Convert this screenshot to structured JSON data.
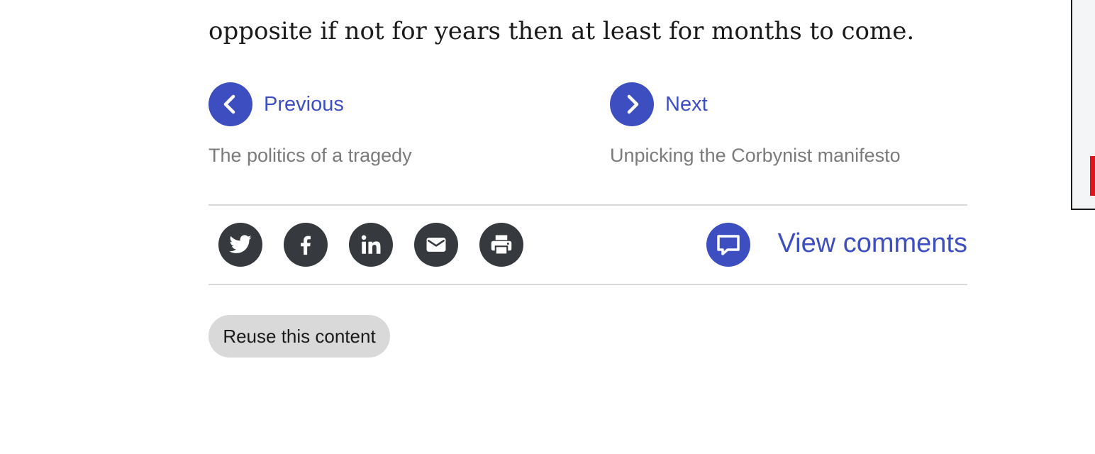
{
  "article": {
    "closing_text": "opposite if not for years then at least for months to come."
  },
  "pagination": {
    "previous": {
      "label": "Previous",
      "title": "The politics of a tragedy",
      "icon": "chevron-left-icon"
    },
    "next": {
      "label": "Next",
      "title": "Unpicking the Corbynist manifesto",
      "icon": "chevron-right-icon"
    }
  },
  "share": {
    "buttons": [
      {
        "name": "twitter",
        "icon": "twitter-icon"
      },
      {
        "name": "facebook",
        "icon": "facebook-icon"
      },
      {
        "name": "linkedin",
        "icon": "linkedin-icon"
      },
      {
        "name": "email",
        "icon": "mail-icon"
      },
      {
        "name": "print",
        "icon": "printer-icon"
      }
    ]
  },
  "comments": {
    "label": "View comments",
    "icon": "comment-bubble-icon"
  },
  "reuse": {
    "label": "Reuse this content"
  },
  "colors": {
    "accent": "#3d4fc0",
    "share_bg": "#363a3e",
    "muted_text": "#7a7a7a",
    "divider": "#d9d9d9",
    "pill_bg": "#d9d9d9",
    "side_accent": "#e0141e"
  }
}
